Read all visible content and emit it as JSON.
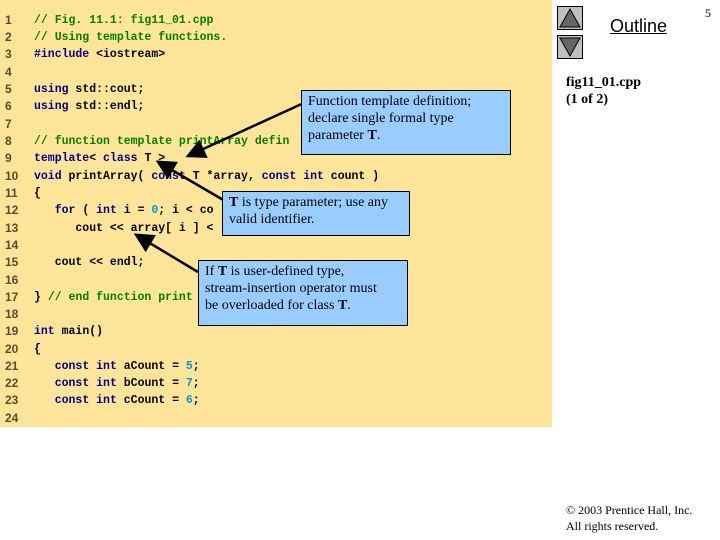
{
  "slide": {
    "page_number": "5",
    "outline_label": "Outline",
    "file_name": "fig11_01.cpp",
    "file_part": "(1 of 2)",
    "copyright_line1": "© 2003 Prentice Hall, Inc.",
    "copyright_line2": "All rights reserved.",
    "nav": {
      "up_icon": "triangle-up-icon",
      "down_icon": "triangle-down-icon"
    }
  },
  "code": {
    "lines": [
      {
        "n": "1",
        "segments": [
          {
            "t": "// Fig. 11.1: fig11_01.cpp",
            "c": "cm"
          }
        ]
      },
      {
        "n": "2",
        "segments": [
          {
            "t": "// Using template functions.",
            "c": "cm"
          }
        ]
      },
      {
        "n": "3",
        "segments": [
          {
            "t": "#include",
            "c": "kw"
          },
          {
            "t": " <iostream>",
            "c": ""
          }
        ]
      },
      {
        "n": "4",
        "segments": []
      },
      {
        "n": "5",
        "segments": [
          {
            "t": "using",
            "c": "kw"
          },
          {
            "t": " std::cout;",
            "c": ""
          }
        ]
      },
      {
        "n": "6",
        "segments": [
          {
            "t": "using",
            "c": "kw"
          },
          {
            "t": " std::endl;",
            "c": ""
          }
        ]
      },
      {
        "n": "7",
        "segments": []
      },
      {
        "n": "8",
        "segments": [
          {
            "t": "// function template printArray defin",
            "c": "cm"
          }
        ]
      },
      {
        "n": "9",
        "segments": [
          {
            "t": "template",
            "c": "kw"
          },
          {
            "t": "< ",
            "c": ""
          },
          {
            "t": "class",
            "c": "kw"
          },
          {
            "t": " T >",
            "c": ""
          }
        ]
      },
      {
        "n": "10",
        "segments": [
          {
            "t": "void",
            "c": "kw"
          },
          {
            "t": " printArray( ",
            "c": ""
          },
          {
            "t": "const",
            "c": "kw"
          },
          {
            "t": " T *array, ",
            "c": ""
          },
          {
            "t": "const",
            "c": "kw"
          },
          {
            "t": " ",
            "c": ""
          },
          {
            "t": "int",
            "c": "kw"
          },
          {
            "t": " count )",
            "c": ""
          }
        ]
      },
      {
        "n": "11",
        "segments": [
          {
            "t": "{",
            "c": ""
          }
        ]
      },
      {
        "n": "12",
        "segments": [
          {
            "t": "   ",
            "c": ""
          },
          {
            "t": "for",
            "c": "kw"
          },
          {
            "t": " ( ",
            "c": ""
          },
          {
            "t": "int",
            "c": "kw"
          },
          {
            "t": " i = ",
            "c": ""
          },
          {
            "t": "0",
            "c": "num"
          },
          {
            "t": "; i < co",
            "c": ""
          }
        ]
      },
      {
        "n": "13",
        "segments": [
          {
            "t": "      cout << array[ i ] <",
            "c": ""
          }
        ]
      },
      {
        "n": "14",
        "segments": []
      },
      {
        "n": "15",
        "segments": [
          {
            "t": "   cout << endl;",
            "c": ""
          }
        ]
      },
      {
        "n": "16",
        "segments": []
      },
      {
        "n": "17",
        "segments": [
          {
            "t": "} ",
            "c": ""
          },
          {
            "t": "// end function print",
            "c": "cm"
          }
        ]
      },
      {
        "n": "18",
        "segments": []
      },
      {
        "n": "19",
        "segments": [
          {
            "t": "int",
            "c": "kw"
          },
          {
            "t": " main()",
            "c": ""
          }
        ]
      },
      {
        "n": "20",
        "segments": [
          {
            "t": "{",
            "c": ""
          }
        ]
      },
      {
        "n": "21",
        "segments": [
          {
            "t": "   ",
            "c": ""
          },
          {
            "t": "const",
            "c": "kw"
          },
          {
            "t": " ",
            "c": ""
          },
          {
            "t": "int",
            "c": "kw"
          },
          {
            "t": " aCount = ",
            "c": ""
          },
          {
            "t": "5",
            "c": "num"
          },
          {
            "t": ";",
            "c": ""
          }
        ]
      },
      {
        "n": "22",
        "segments": [
          {
            "t": "   ",
            "c": ""
          },
          {
            "t": "const",
            "c": "kw"
          },
          {
            "t": " ",
            "c": ""
          },
          {
            "t": "int",
            "c": "kw"
          },
          {
            "t": " bCount = ",
            "c": ""
          },
          {
            "t": "7",
            "c": "num"
          },
          {
            "t": ";",
            "c": ""
          }
        ]
      },
      {
        "n": "23",
        "segments": [
          {
            "t": "   ",
            "c": ""
          },
          {
            "t": "const",
            "c": "kw"
          },
          {
            "t": " ",
            "c": ""
          },
          {
            "t": "int",
            "c": "kw"
          },
          {
            "t": " cCount = ",
            "c": ""
          },
          {
            "t": "6",
            "c": "num"
          },
          {
            "t": ";",
            "c": ""
          }
        ]
      },
      {
        "n": "24",
        "segments": []
      }
    ]
  },
  "callouts": {
    "template_def": {
      "line1": "Function template definition;",
      "line2": "declare single formal type",
      "line3_pre": "parameter ",
      "line3_bold": "T",
      "line3_post": "."
    },
    "type_param": {
      "line1_bold": "T",
      "line1_post": " is type parameter; use any",
      "line2": "valid identifier."
    },
    "user_defined": {
      "line1_pre": "If ",
      "line1_bold": "T",
      "line1_post": " is user-defined type,",
      "line2": "stream-insertion operator must",
      "line3_pre": "be overloaded for class ",
      "line3_bold": "T",
      "line3_post": "."
    }
  },
  "colors": {
    "code_background": "#ffe599",
    "callout_background": "#99ccff",
    "keyword": "#000080",
    "comment": "#008000",
    "number": "#0099cc",
    "nav_button": "#c0c0c0"
  }
}
